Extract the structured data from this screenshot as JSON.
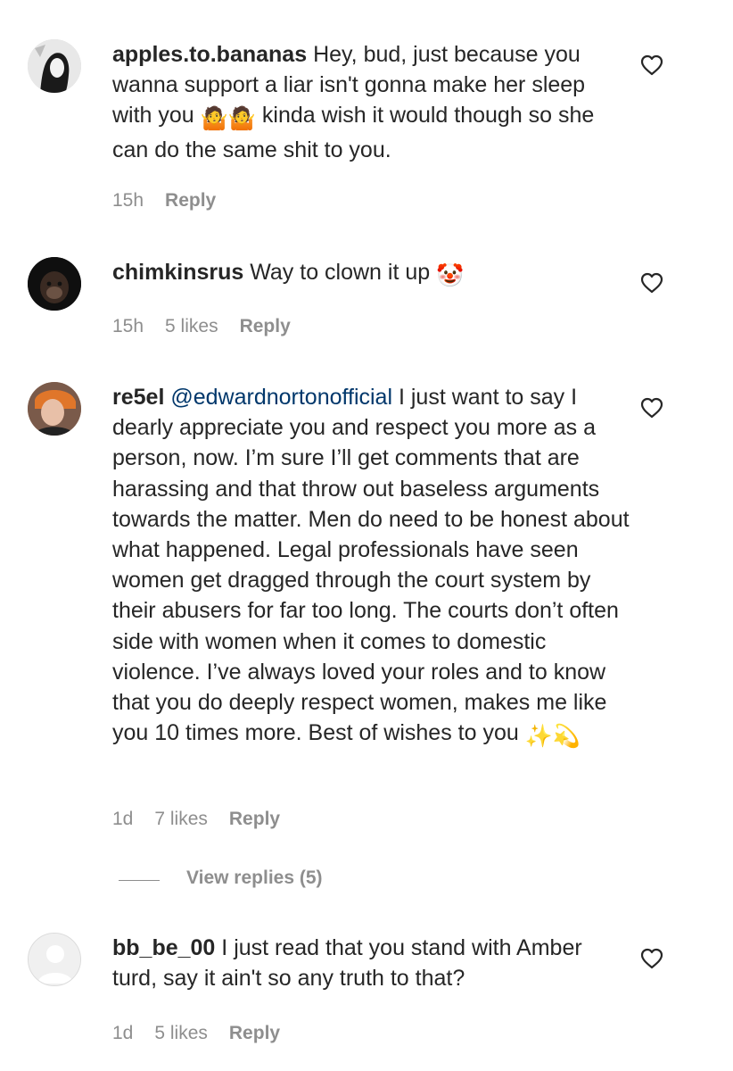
{
  "comments": [
    {
      "username": "apples.to.bananas",
      "text_a": "Hey, bud, just because you wanna support a liar isn't gonna make her sleep with you",
      "text_b": "kinda wish it would though so she can do the same shit to you.",
      "emoji": "🤷🤷",
      "time": "15h",
      "likes": "",
      "reply_label": "Reply",
      "icon": "heart-outline-icon"
    },
    {
      "username": "chimkinsrus",
      "text_a": "Way to clown it up",
      "emoji": "🤡",
      "time": "15h",
      "likes": "5 likes",
      "reply_label": "Reply",
      "icon": "heart-outline-icon"
    },
    {
      "username": "re5el",
      "mention": "@edwardnortonofficial",
      "text_a": "I just want to say I dearly appreciate you and respect you more as a person, now. I’m sure I’ll get comments that are harassing and that throw out baseless arguments towards the matter. Men do need to be honest about what happened. Legal professionals have seen women get dragged through the court system by their abusers for far too long. The courts don’t often side with women when it comes to domestic violence. I’ve always loved your roles and to know that you do deeply respect women, makes me like you 10 times more. Best of wishes to you",
      "emoji": "✨💫",
      "time": "1d",
      "likes": "7 likes",
      "reply_label": "Reply",
      "icon": "heart-outline-icon"
    },
    {
      "username": "bb_be_00",
      "text_a": "I just read that you stand with Amber turd, say it ain't so any truth to that?",
      "time": "1d",
      "likes": "5 likes",
      "reply_label": "Reply",
      "icon": "heart-outline-icon"
    }
  ],
  "view_replies": "View replies (5)",
  "colors": {
    "text": "#262626",
    "secondary": "#8e8e8e",
    "mention": "#00376b"
  }
}
